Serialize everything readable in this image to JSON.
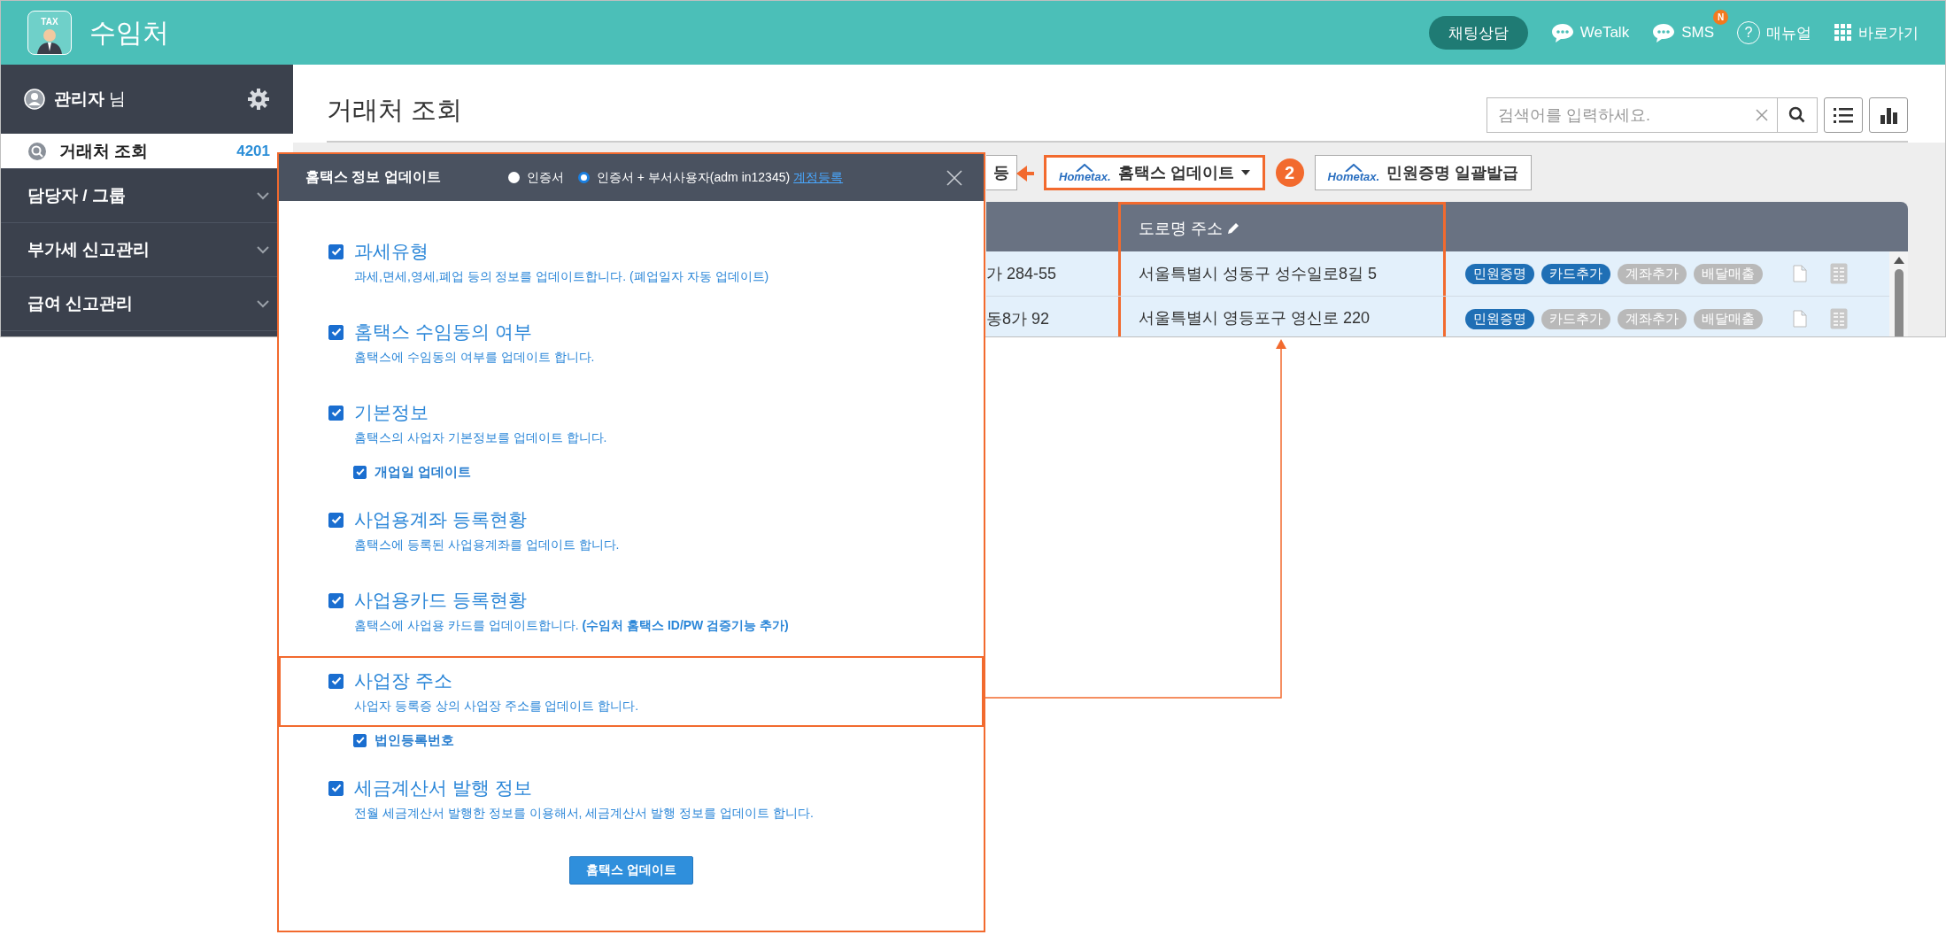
{
  "header": {
    "logo_text": "TAX",
    "title": "수임처",
    "chat_button": "채팅상담",
    "links": [
      {
        "kind": "chat",
        "label": "WeTalk"
      },
      {
        "kind": "chat",
        "label": "SMS",
        "badge": "N"
      },
      {
        "kind": "help",
        "icon_text": "?",
        "label": "매뉴얼"
      },
      {
        "kind": "grid",
        "label": "바로가기"
      }
    ]
  },
  "sidebar": {
    "user": {
      "name": "관리자",
      "suffix": "님"
    },
    "items": [
      {
        "label": "거래처 조회",
        "count": "4201",
        "selected": true
      },
      {
        "label": "담당자 / 그룹",
        "selected": false
      },
      {
        "label": "부가세 신고관리",
        "selected": false
      },
      {
        "label": "급여 신고관리",
        "selected": false
      }
    ]
  },
  "page": {
    "title": "거래처 조회",
    "search": {
      "placeholder": "검색어를 입력하세요."
    }
  },
  "toolbar": {
    "buttons": [
      {
        "kind": "plain",
        "label": "등",
        "dropdown": false,
        "highlighted": false
      },
      {
        "kind": "hometax",
        "logo": "Hometax.",
        "label": "홈택스 업데이트",
        "dropdown": true,
        "highlighted": true
      },
      {
        "kind": "hometax",
        "logo": "Hometax.",
        "label": "민원증명 일괄발급",
        "dropdown": false,
        "highlighted": false
      }
    ]
  },
  "step_badge": "2",
  "table": {
    "columns": [
      {
        "label": "도로명 주소",
        "editable": true,
        "highlighted": true
      }
    ],
    "rows": [
      {
        "column_1": "가 284-55",
        "address": "서울특별시 성동구 성수일로8길 5",
        "tags": [
          {
            "label": "민원증명",
            "on": true
          },
          {
            "label": "카드추가",
            "on": true
          },
          {
            "label": "계좌추가",
            "on": false
          },
          {
            "label": "배달매출",
            "on": false
          }
        ]
      },
      {
        "column_1": "동8가 92",
        "address": "서울특별시 영등포구 영신로 220",
        "tags": [
          {
            "label": "민원증명",
            "on": true
          },
          {
            "label": "카드추가",
            "on": false
          },
          {
            "label": "계좌추가",
            "on": false
          },
          {
            "label": "배달매출",
            "on": false
          }
        ]
      }
    ]
  },
  "dialog": {
    "title": "홈택스 정보 업데이트",
    "options": [
      {
        "label": "인증서",
        "selected": false
      },
      {
        "label": "인증서 + 부서사용자(adm in12345)",
        "selected": true
      }
    ],
    "link": "계정등록",
    "sections": [
      {
        "title": "과세유형",
        "description": "과세,면세,영세,폐업 등의 정보를 업데이트합니다. (폐업일자 자동 업데이트)",
        "checked": true,
        "highlighted": false
      },
      {
        "title": "홈택스 수임동의 여부",
        "description": "홈택스에 수임동의 여부를 업데이트 합니다.",
        "checked": true,
        "highlighted": false
      },
      {
        "title": "기본정보",
        "description": "홈택스의 사업자 기본정보를 업데이트 합니다.",
        "checked": true,
        "highlighted": false,
        "sub": {
          "label": "개업일 업데이트",
          "checked": true
        }
      },
      {
        "title": "사업용계좌 등록현황",
        "description": "홈택스에 등록된 사업용계좌를 업데이트 합니다.",
        "checked": true,
        "highlighted": false
      },
      {
        "title": "사업용카드 등록현황",
        "description": "홈택스에 사업용 카드를 업데이트합니다. **(수임처 홈택스 ID/PW 검증기능 추가)**",
        "checked": true,
        "highlighted": false
      },
      {
        "title": "사업장 주소",
        "description": "사업자 등록증 상의 사업장 주소를 업데이트 합니다.",
        "checked": true,
        "highlighted": true,
        "sub": {
          "label": "법인등록번호",
          "checked": true
        }
      },
      {
        "title": "세금계산서 발행 정보",
        "description": "전월 세금계산서 발행한 정보를 이용해서, 세금계산서 발행 정보를 업데이트 합니다.",
        "checked": true,
        "highlighted": false
      }
    ],
    "button": "홈택스 업데이트"
  }
}
